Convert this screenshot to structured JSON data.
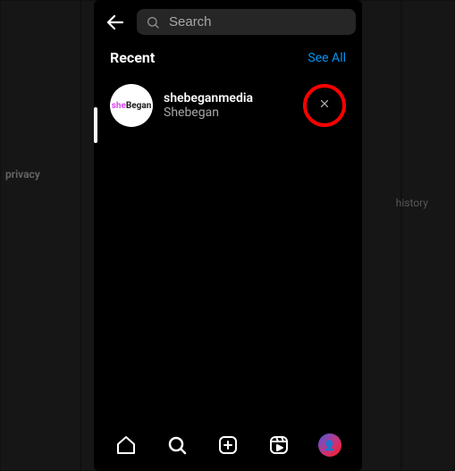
{
  "search": {
    "placeholder": "Search",
    "value": ""
  },
  "recent": {
    "title": "Recent",
    "see_all": "See All",
    "items": [
      {
        "username": "shebeganmedia",
        "fullname": "Shebegan",
        "avatar_text_a": "she",
        "avatar_text_b": "Began"
      }
    ]
  },
  "background": {
    "privacy": "privacy",
    "history": "history"
  },
  "icons": {
    "back": "←",
    "search": "⌕",
    "close": "✕",
    "home": "⌂",
    "explore": "⌕",
    "create": "⊞",
    "reels": "▣",
    "profile": "P"
  },
  "colors": {
    "accent": "#0095f6",
    "highlight_ring": "#ff0000"
  }
}
